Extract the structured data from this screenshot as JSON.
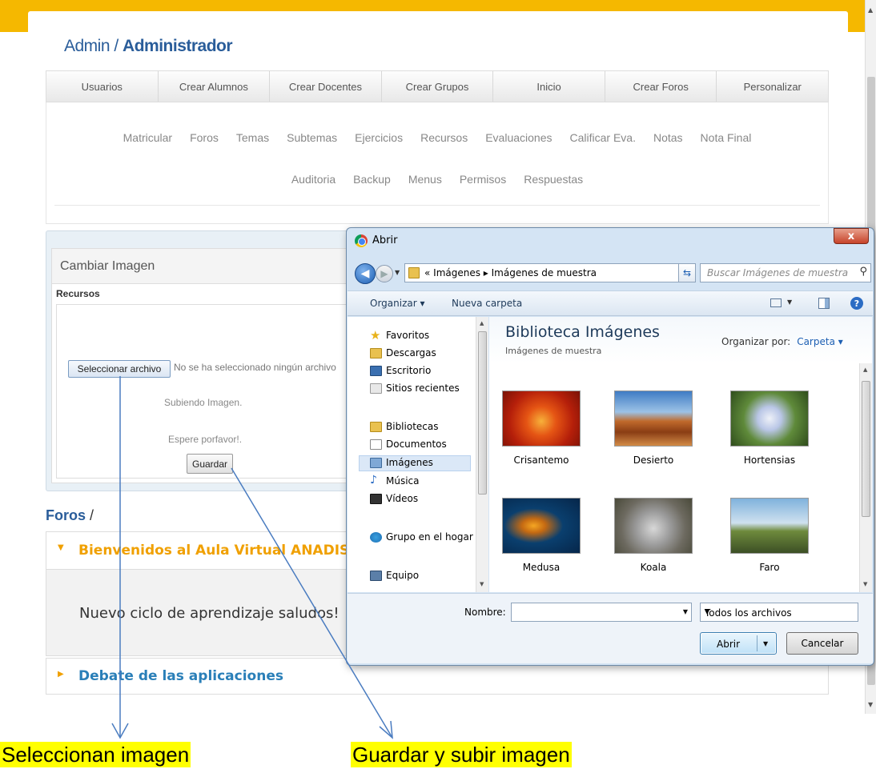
{
  "header": {
    "admin_prefix": "Admin /",
    "role": "Administrador"
  },
  "navbar": [
    "Usuarios",
    "Crear Alumnos",
    "Crear Docentes",
    "Crear Grupos",
    "Inicio",
    "Crear Foros",
    "Personalizar"
  ],
  "subnav": {
    "row1": [
      "Matricular",
      "Foros",
      "Temas",
      "Subtemas",
      "Ejercicios",
      "Recursos",
      "Evaluaciones",
      "Calificar Eva.",
      "Notas",
      "Nota Final"
    ],
    "row2": [
      "Auditoria",
      "Backup",
      "Menus",
      "Permisos",
      "Respuestas"
    ]
  },
  "panel": {
    "title": "Cambiar Imagen",
    "section": "Recursos",
    "file_button": "Seleccionar archivo",
    "file_status": "No se ha seleccionado ningún archivo",
    "uploading": "Subiendo Imagen.",
    "wait": "Espere porfavor!.",
    "save_button": "Guardar"
  },
  "foros": {
    "crumb": "Foros",
    "slash": "/",
    "items": [
      {
        "title": "Bienvenidos al Aula Virtual ANADISE",
        "body": "Nuevo ciclo de aprendizaje saludos!"
      },
      {
        "title": "Debate de las aplicaciones"
      }
    ]
  },
  "annotations": {
    "left": "Seleccionan imagen",
    "right": "Guardar y subir imagen"
  },
  "dialog": {
    "title": "Abrir",
    "close": "x",
    "breadcrumb": "«  Imágenes  ▸  Imágenes de muestra",
    "search_placeholder": "Buscar Imágenes de muestra",
    "toolbar": {
      "organize": "Organizar ▾",
      "new_folder": "Nueva carpeta"
    },
    "nav": {
      "favorites": "Favoritos",
      "downloads": "Descargas",
      "desktop": "Escritorio",
      "recent": "Sitios recientes",
      "libraries": "Bibliotecas",
      "documents": "Documentos",
      "images": "Imágenes",
      "music": "Música",
      "videos": "Vídeos",
      "homegroup": "Grupo en el hogar",
      "computer": "Equipo"
    },
    "library_title": "Biblioteca Imágenes",
    "library_sub": "Imágenes de muestra",
    "arrange_label": "Organizar por:",
    "arrange_value": "Carpeta ▾",
    "files": [
      "Crisantemo",
      "Desierto",
      "Hortensias",
      "Medusa",
      "Koala",
      "Faro"
    ],
    "filename_label": "Nombre:",
    "filename_value": "",
    "filetype": "Todos los archivos",
    "open_button": "Abrir",
    "cancel_button": "Cancelar"
  }
}
